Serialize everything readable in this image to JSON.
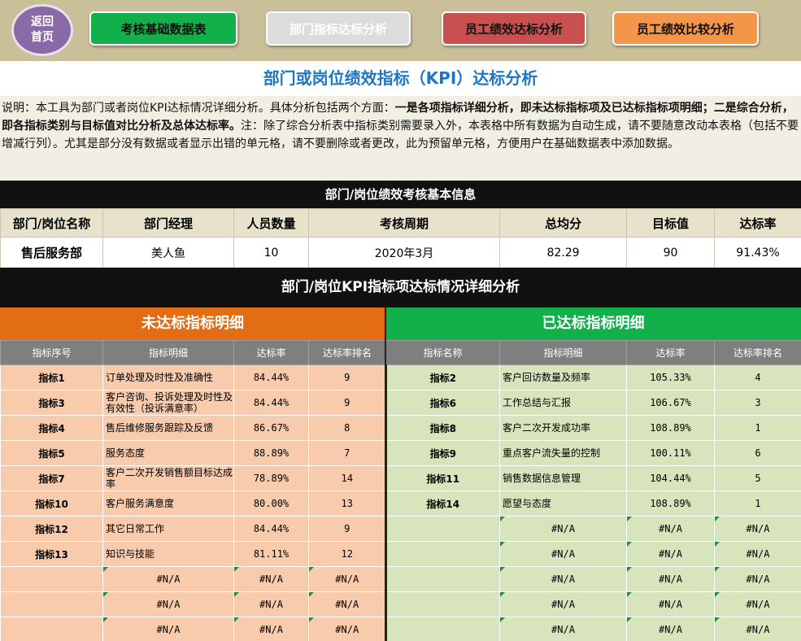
{
  "nav": {
    "home_line1": "返回",
    "home_line2": "首页",
    "btn1": "考核基础数据表",
    "btn2": "部门指标达标分析",
    "btn3": "员工绩效达标分析",
    "btn4": "员工绩效比较分析"
  },
  "title": "部门或岗位绩效指标（KPI）达标分析",
  "description": {
    "p1": "说明：本工具为部门或者岗位KPI达标情况详细分析。具体分析包括两个方面：",
    "p2": "一是各项指标详细分析，即未达标指标项及已达标指标项明细；二是综合分析，即各指标类别与目标值对比分析及总体达标率。",
    "p3": "注：除了综合分析表中指标类别需要录入外，本表格中所有数据为自动生成，请不要随意改动本表格（包括不要增减行列）。尤其是部分没有数据或者显示出错的单元格，请不要删除或者更改，此为预留单元格，方便用户在基础数据表中添加数据。"
  },
  "info": {
    "title": "部门/岗位绩效考核基本信息",
    "headers": [
      "部门/岗位名称",
      "部门经理",
      "人员数量",
      "考核周期",
      "总均分",
      "目标值",
      "达标率"
    ],
    "values": [
      "售后服务部",
      "美人鱼",
      "10",
      "2020年3月",
      "82.29",
      "90",
      "91.43%"
    ]
  },
  "detail": {
    "title": "部门/岗位KPI指标项达标情况详细分析",
    "left_title": "未达标指标明细",
    "right_title": "已达标指标明细",
    "left_headers": [
      "指标序号",
      "指标明细",
      "达标率",
      "达标率排名"
    ],
    "right_headers": [
      "指标名称",
      "指标明细",
      "达标率",
      "达标率排名"
    ],
    "rows": [
      {
        "l": [
          "指标1",
          "订单处理及时性及准确性",
          "84.44%",
          "9"
        ],
        "r": [
          "指标2",
          "客户回访数量及频率",
          "105.33%",
          "4"
        ]
      },
      {
        "l": [
          "指标3",
          "客户咨询、投诉处理及时性及有效性（投诉满意率）",
          "84.44%",
          "9"
        ],
        "r": [
          "指标6",
          "工作总结与汇报",
          "106.67%",
          "3"
        ]
      },
      {
        "l": [
          "指标4",
          "售后维修服务跟踪及反馈",
          "86.67%",
          "8"
        ],
        "r": [
          "指标8",
          "客户二次开发成功率",
          "108.89%",
          "1"
        ]
      },
      {
        "l": [
          "指标5",
          "服务态度",
          "88.89%",
          "7"
        ],
        "r": [
          "指标9",
          "重点客户流失量的控制",
          "100.11%",
          "6"
        ]
      },
      {
        "l": [
          "指标7",
          "客户二次开发销售额目标达成率",
          "78.89%",
          "14"
        ],
        "r": [
          "指标11",
          "销售数据信息管理",
          "104.44%",
          "5"
        ]
      },
      {
        "l": [
          "指标10",
          "客户服务满意度",
          "80.00%",
          "13"
        ],
        "r": [
          "指标14",
          "愿望与态度",
          "108.89%",
          "1"
        ]
      },
      {
        "l": [
          "指标12",
          "其它日常工作",
          "84.44%",
          "9"
        ],
        "r": [
          "",
          "#N/A",
          "#N/A",
          "#N/A"
        ]
      },
      {
        "l": [
          "指标13",
          "知识与技能",
          "81.11%",
          "12"
        ],
        "r": [
          "",
          "#N/A",
          "#N/A",
          "#N/A"
        ]
      },
      {
        "l": [
          "",
          "#N/A",
          "#N/A",
          "#N/A"
        ],
        "r": [
          "",
          "#N/A",
          "#N/A",
          "#N/A"
        ]
      },
      {
        "l": [
          "",
          "#N/A",
          "#N/A",
          "#N/A"
        ],
        "r": [
          "",
          "#N/A",
          "#N/A",
          "#N/A"
        ]
      },
      {
        "l": [
          "",
          "#N/A",
          "#N/A",
          "#N/A"
        ],
        "r": [
          "",
          "#N/A",
          "#N/A",
          "#N/A"
        ]
      }
    ]
  },
  "colors": {
    "topbar": "#c9c09a",
    "title": "#1f77c2",
    "left_header": "#e26d14",
    "right_header": "#11b04a",
    "left_cell": "#f8cbad",
    "right_cell": "#d8e4bc"
  }
}
